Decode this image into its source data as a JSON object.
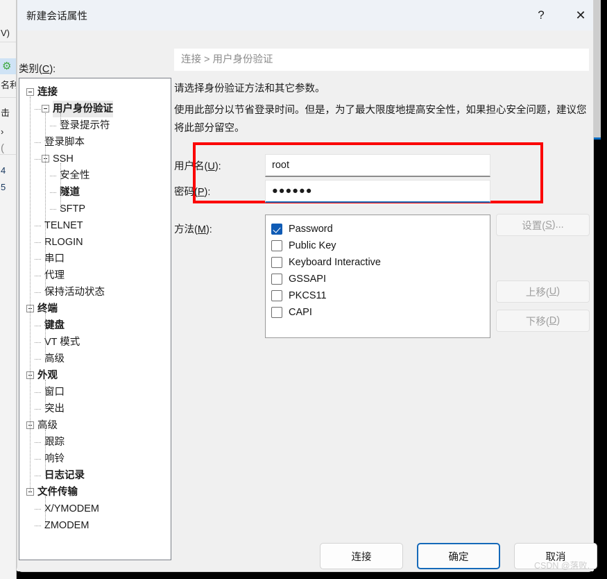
{
  "window": {
    "title": "新建会话属性",
    "help_icon": "?",
    "close_icon": "✕"
  },
  "background_app": {
    "rows": [
      "V)",
      "名利",
      "击",
      "›",
      "(",
      "4",
      "5"
    ],
    "gear_icon": "gear-icon"
  },
  "category": {
    "label_prefix": "类别(",
    "label_key": "C",
    "label_suffix": "):"
  },
  "tree": {
    "items": [
      {
        "label": "连接",
        "depth": 0,
        "bold": true,
        "expander": true,
        "selected": false
      },
      {
        "label": "用户身份验证",
        "depth": 1,
        "bold": true,
        "expander": true,
        "selected": true
      },
      {
        "label": "登录提示符",
        "depth": 2,
        "bold": false,
        "expander": false,
        "selected": false
      },
      {
        "label": "登录脚本",
        "depth": 1,
        "bold": false,
        "expander": false,
        "selected": false
      },
      {
        "label": "SSH",
        "depth": 1,
        "bold": false,
        "expander": true,
        "selected": false
      },
      {
        "label": "安全性",
        "depth": 2,
        "bold": false,
        "expander": false,
        "selected": false
      },
      {
        "label": "隧道",
        "depth": 2,
        "bold": true,
        "expander": false,
        "selected": false
      },
      {
        "label": "SFTP",
        "depth": 2,
        "bold": false,
        "expander": false,
        "selected": false
      },
      {
        "label": "TELNET",
        "depth": 1,
        "bold": false,
        "expander": false,
        "selected": false
      },
      {
        "label": "RLOGIN",
        "depth": 1,
        "bold": false,
        "expander": false,
        "selected": false
      },
      {
        "label": "串口",
        "depth": 1,
        "bold": false,
        "expander": false,
        "selected": false
      },
      {
        "label": "代理",
        "depth": 1,
        "bold": false,
        "expander": false,
        "selected": false
      },
      {
        "label": "保持活动状态",
        "depth": 1,
        "bold": false,
        "expander": false,
        "selected": false
      },
      {
        "label": "终端",
        "depth": 0,
        "bold": true,
        "expander": true,
        "selected": false
      },
      {
        "label": "键盘",
        "depth": 1,
        "bold": true,
        "expander": false,
        "selected": false
      },
      {
        "label": "VT 模式",
        "depth": 1,
        "bold": false,
        "expander": false,
        "selected": false
      },
      {
        "label": "高级",
        "depth": 1,
        "bold": false,
        "expander": false,
        "selected": false
      },
      {
        "label": "外观",
        "depth": 0,
        "bold": true,
        "expander": true,
        "selected": false
      },
      {
        "label": "窗口",
        "depth": 1,
        "bold": false,
        "expander": false,
        "selected": false
      },
      {
        "label": "突出",
        "depth": 1,
        "bold": false,
        "expander": false,
        "selected": false
      },
      {
        "label": "高级",
        "depth": 0,
        "bold": false,
        "expander": true,
        "selected": false
      },
      {
        "label": "跟踪",
        "depth": 1,
        "bold": false,
        "expander": false,
        "selected": false
      },
      {
        "label": "响铃",
        "depth": 1,
        "bold": false,
        "expander": false,
        "selected": false
      },
      {
        "label": "日志记录",
        "depth": 1,
        "bold": true,
        "expander": false,
        "selected": false
      },
      {
        "label": "文件传输",
        "depth": 0,
        "bold": true,
        "expander": true,
        "selected": false
      },
      {
        "label": "X/YMODEM",
        "depth": 1,
        "bold": false,
        "expander": false,
        "selected": false
      },
      {
        "label": "ZMODEM",
        "depth": 1,
        "bold": false,
        "expander": false,
        "selected": false
      }
    ]
  },
  "pane": {
    "breadcrumb": "连接 > 用户身份验证",
    "description_line1": "请选择身份验证方法和其它参数。",
    "description_line2": "使用此部分以节省登录时间。但是，为了最大限度地提高安全性，如果担心安全问题，建议您将此部分留空。",
    "username": {
      "label_prefix": "用户名(",
      "label_key": "U",
      "label_suffix": "):",
      "value": "root",
      "placeholder": ""
    },
    "password": {
      "label_prefix": "密码(",
      "label_key": "P",
      "label_suffix": "):",
      "value": "●●●●●●",
      "placeholder": ""
    },
    "method": {
      "label_prefix": "方法(",
      "label_key": "M",
      "label_suffix": "):",
      "options": [
        {
          "label": "Password",
          "checked": true
        },
        {
          "label": "Public Key",
          "checked": false
        },
        {
          "label": "Keyboard Interactive",
          "checked": false
        },
        {
          "label": "GSSAPI",
          "checked": false
        },
        {
          "label": "PKCS11",
          "checked": false
        },
        {
          "label": "CAPI",
          "checked": false
        }
      ]
    },
    "side_buttons": [
      {
        "prefix": "设置(",
        "key": "S",
        "suffix": ")...",
        "enabled": false
      },
      {
        "prefix": "上移(",
        "key": "U",
        "suffix": ")",
        "enabled": false
      },
      {
        "prefix": "下移(",
        "key": "D",
        "suffix": ")",
        "enabled": false
      }
    ]
  },
  "footer": {
    "connect_label": "连接",
    "ok_label": "确定",
    "cancel_label": "取消"
  },
  "watermark": "CSDN @落败.",
  "colors": {
    "accent": "#0f5bb5",
    "highlight_red": "#fb0404",
    "focus_blue": "#1569b9",
    "dialog_bg": "#f0f0f0",
    "titlebar_bg": "#eef2f7"
  }
}
